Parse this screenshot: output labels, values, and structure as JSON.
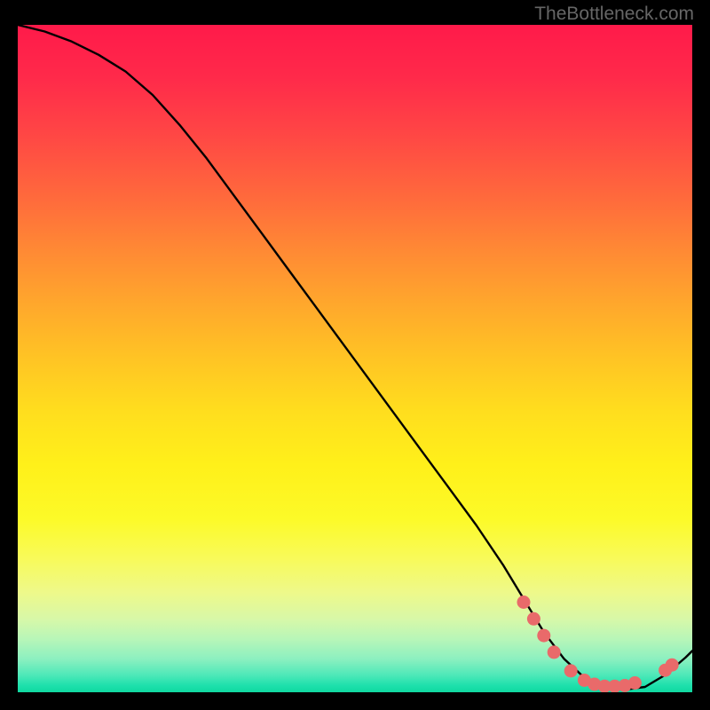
{
  "watermark": "TheBottleneck.com",
  "chart_data": {
    "type": "line",
    "title": "",
    "xlabel": "",
    "ylabel": "",
    "xlim": [
      0,
      100
    ],
    "ylim": [
      0,
      100
    ],
    "grid": false,
    "series": [
      {
        "name": "curve",
        "x": [
          0,
          4,
          8,
          12,
          16,
          20,
          24,
          28,
          32,
          36,
          40,
          44,
          48,
          52,
          56,
          60,
          64,
          68,
          72,
          75,
          78,
          81,
          84,
          87,
          90,
          93,
          96,
          99,
          100
        ],
        "y": [
          100,
          99,
          97.5,
          95.5,
          93,
          89.5,
          85,
          80,
          74.5,
          69,
          63.5,
          58,
          52.5,
          47,
          41.5,
          36,
          30.5,
          25,
          19,
          14,
          9,
          5,
          2.2,
          0.8,
          0.4,
          0.8,
          2.6,
          5.2,
          6.2
        ]
      }
    ],
    "markers": [
      {
        "x": 75,
        "y": 13.5
      },
      {
        "x": 76.5,
        "y": 11
      },
      {
        "x": 78,
        "y": 8.5
      },
      {
        "x": 79.5,
        "y": 6
      },
      {
        "x": 82,
        "y": 3.2
      },
      {
        "x": 84,
        "y": 1.8
      },
      {
        "x": 85.5,
        "y": 1.2
      },
      {
        "x": 87,
        "y": 0.9
      },
      {
        "x": 88.5,
        "y": 0.9
      },
      {
        "x": 90,
        "y": 1.0
      },
      {
        "x": 91.5,
        "y": 1.4
      },
      {
        "x": 96,
        "y": 3.3
      },
      {
        "x": 97,
        "y": 4.1
      }
    ],
    "gradient_stops": [
      {
        "pos": 0,
        "color": "#ff1a4a"
      },
      {
        "pos": 50,
        "color": "#ffc424"
      },
      {
        "pos": 100,
        "color": "#10d8a0"
      }
    ]
  }
}
